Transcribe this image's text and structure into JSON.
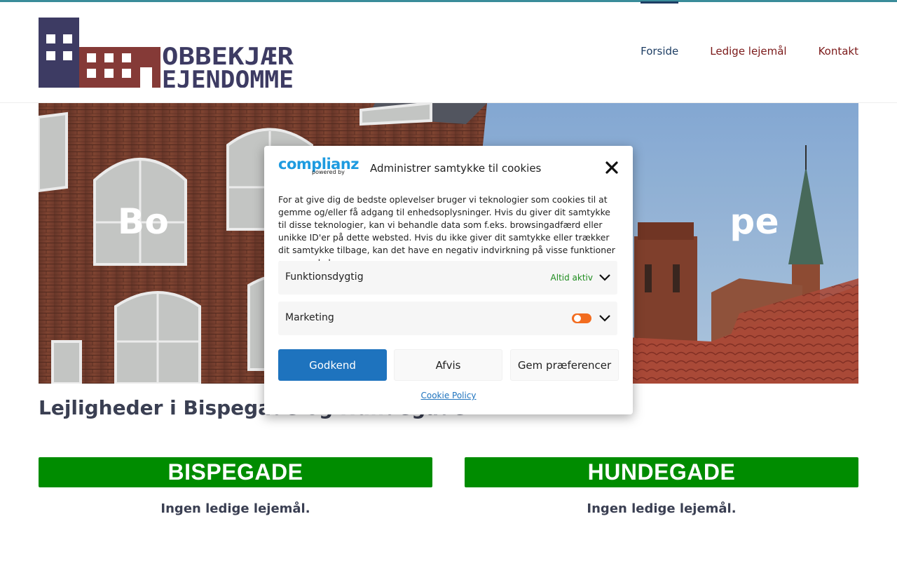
{
  "colors": {
    "topbar": "#3a8c9a",
    "nav_text": "#7b1919",
    "nav_active": "#1e3e64",
    "banner_green": "#008c00",
    "accept_button": "#1e73be",
    "toggle_orange": "#f26c1f"
  },
  "header": {
    "logo": {
      "line1": "OBBEKJÆR",
      "line2": "EJENDOMME"
    },
    "nav": [
      {
        "label": "Forside",
        "active": true
      },
      {
        "label": "Ledige lejemål",
        "active": false
      },
      {
        "label": "Kontakt",
        "active": false
      }
    ]
  },
  "hero": {
    "title_left": "Bo",
    "title_right": "pe"
  },
  "main": {
    "subheading": "Lejligheder i Bispegade og Hundegade",
    "columns": [
      {
        "title": "BISPEGADE",
        "status": "Ingen ledige lejemål."
      },
      {
        "title": "HUNDEGADE",
        "status": "Ingen ledige lejemål."
      }
    ]
  },
  "cookie_modal": {
    "brand": {
      "name": "complianz",
      "powered_by": "powered by"
    },
    "title": "Administrer samtykke til cookies",
    "close_icon": "close-icon",
    "body": "For at give dig de bedste oplevelser bruger vi teknologier som cookies til at gemme og/eller få adgang til enhedsoplysninger. Hvis du giver dit samtykke til disse teknologier, kan vi behandle data som f.eks. browsingadfærd eller unikke ID'er på dette websted. Hvis du ikke giver dit samtykke eller trækker dit samtykke tilbage, kan det have en negativ indvirkning på visse funktioner og egenskaber.",
    "preferences": [
      {
        "label": "Funktionsdygtig",
        "status": "Altid aktiv"
      },
      {
        "label": "Marketing",
        "toggle": "on"
      }
    ],
    "buttons": {
      "accept": "Godkend",
      "deny": "Afvis",
      "save": "Gem præferencer"
    },
    "policy_link": "Cookie Policy"
  }
}
